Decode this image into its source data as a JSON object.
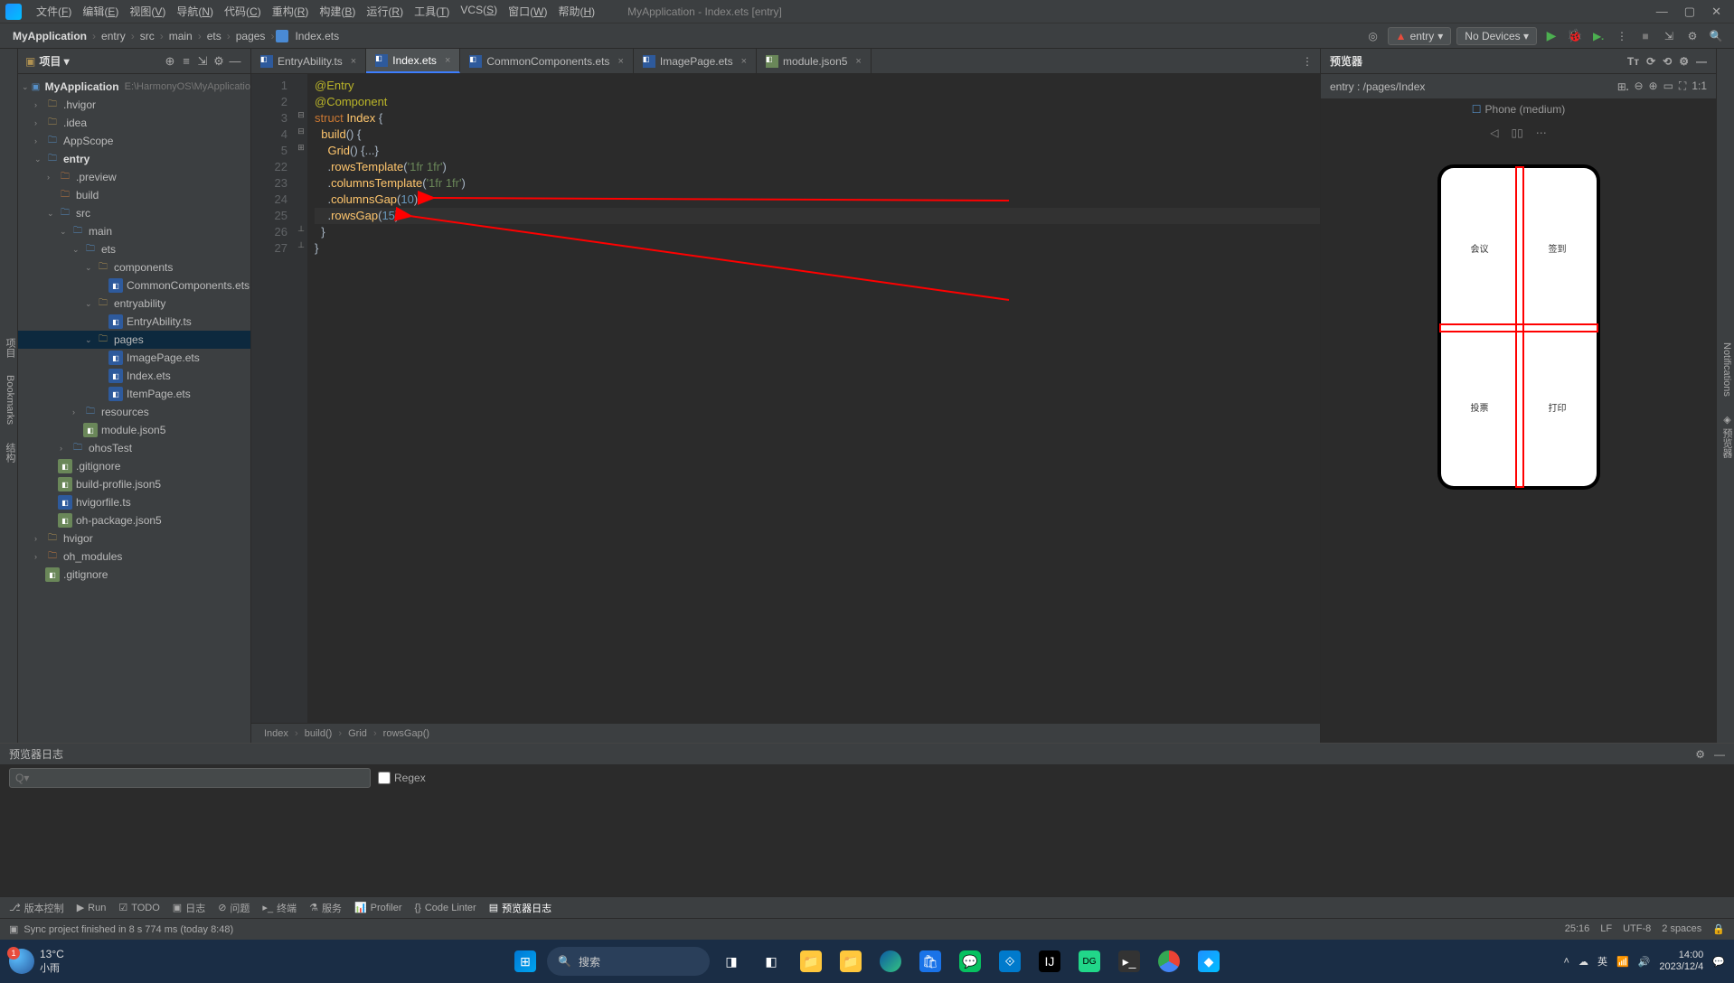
{
  "menubar": {
    "items": [
      "文件(F)",
      "编辑(E)",
      "视图(V)",
      "导航(N)",
      "代码(C)",
      "重构(R)",
      "构建(B)",
      "运行(R)",
      "工具(T)",
      "VCS(S)",
      "窗口(W)",
      "帮助(H)"
    ],
    "title": "MyApplication - Index.ets [entry]"
  },
  "breadcrumbs": [
    "MyApplication",
    "entry",
    "src",
    "main",
    "ets",
    "pages",
    "Index.ets"
  ],
  "navbar_right": {
    "entry_combo": "entry",
    "devices_combo": "No Devices ▾"
  },
  "project_panel": {
    "title": "项目 ▾",
    "root": {
      "name": "MyApplication",
      "path": "E:\\HarmonyOS\\MyApplicatio"
    },
    "tree": [
      {
        "d": 1,
        "a": "›",
        "i": "folder",
        "l": ".hvigor"
      },
      {
        "d": 1,
        "a": "›",
        "i": "folder",
        "l": ".idea"
      },
      {
        "d": 1,
        "a": "›",
        "i": "folder-blue",
        "l": "AppScope"
      },
      {
        "d": 1,
        "a": "⌄",
        "i": "folder-blue",
        "l": "entry",
        "bold": true
      },
      {
        "d": 2,
        "a": "›",
        "i": "folder-orange",
        "l": ".preview"
      },
      {
        "d": 2,
        "a": "",
        "i": "folder-orange",
        "l": "build"
      },
      {
        "d": 2,
        "a": "⌄",
        "i": "folder-blue",
        "l": "src"
      },
      {
        "d": 3,
        "a": "⌄",
        "i": "folder-blue",
        "l": "main"
      },
      {
        "d": 4,
        "a": "⌄",
        "i": "folder-blue",
        "l": "ets"
      },
      {
        "d": 5,
        "a": "⌄",
        "i": "folder",
        "l": "components"
      },
      {
        "d": 6,
        "a": "",
        "i": "file-ets",
        "l": "CommonComponents.ets"
      },
      {
        "d": 5,
        "a": "⌄",
        "i": "folder",
        "l": "entryability"
      },
      {
        "d": 6,
        "a": "",
        "i": "file-ts",
        "l": "EntryAbility.ts"
      },
      {
        "d": 5,
        "a": "⌄",
        "i": "folder",
        "l": "pages",
        "sel": true
      },
      {
        "d": 6,
        "a": "",
        "i": "file-ets",
        "l": "ImagePage.ets"
      },
      {
        "d": 6,
        "a": "",
        "i": "file-ets",
        "l": "Index.ets"
      },
      {
        "d": 6,
        "a": "",
        "i": "file-ets",
        "l": "ItemPage.ets"
      },
      {
        "d": 4,
        "a": "›",
        "i": "folder-blue",
        "l": "resources"
      },
      {
        "d": 4,
        "a": "",
        "i": "file-json",
        "l": "module.json5"
      },
      {
        "d": 3,
        "a": "›",
        "i": "folder-blue",
        "l": "ohosTest"
      },
      {
        "d": 2,
        "a": "",
        "i": "file-json",
        "l": ".gitignore"
      },
      {
        "d": 2,
        "a": "",
        "i": "file-json",
        "l": "build-profile.json5"
      },
      {
        "d": 2,
        "a": "",
        "i": "file-ts",
        "l": "hvigorfile.ts"
      },
      {
        "d": 2,
        "a": "",
        "i": "file-json",
        "l": "oh-package.json5"
      },
      {
        "d": 1,
        "a": "›",
        "i": "folder",
        "l": "hvigor"
      },
      {
        "d": 1,
        "a": "›",
        "i": "folder-orange",
        "l": "oh_modules"
      },
      {
        "d": 1,
        "a": "",
        "i": "file-json",
        "l": ".gitignore"
      }
    ]
  },
  "tabs": [
    {
      "label": "EntryAbility.ts",
      "icon": "file-ts"
    },
    {
      "label": "Index.ets",
      "icon": "file-ets",
      "active": true
    },
    {
      "label": "CommonComponents.ets",
      "icon": "file-ets"
    },
    {
      "label": "ImagePage.ets",
      "icon": "file-ets"
    },
    {
      "label": "module.json5",
      "icon": "file-json"
    }
  ],
  "code": {
    "line_numbers": [
      "1",
      "2",
      "3",
      "4",
      "5",
      "22",
      "23",
      "24",
      "25",
      "26",
      "27"
    ],
    "lines": [
      {
        "t": "@Entry",
        "cls": "ann"
      },
      {
        "t": "@Component",
        "cls": "ann"
      },
      {
        "raw": "<span class='kw'>struct</span> <span class='fn'>Index</span> {"
      },
      {
        "raw": "  <span class='fn'>build</span>() {"
      },
      {
        "raw": "    <span class='fn'>Grid</span>() {...}"
      },
      {
        "raw": "    .<span class='fn'>rowsTemplate</span>(<span class='str'>'1fr 1fr'</span>)"
      },
      {
        "raw": "    .<span class='fn'>columnsTemplate</span>(<span class='str'>'1fr 1fr'</span>)"
      },
      {
        "raw": "    .<span class='fn'>columnsGap</span>(<span class='num'>10</span>)"
      },
      {
        "raw": "    .<span class='fn'>rowsGap</span>(<span class='num'>15</span>)",
        "cur": true
      },
      {
        "t": "  }"
      },
      {
        "t": "}"
      }
    ]
  },
  "code_breadcrumb": [
    "Index",
    "build()",
    "Grid",
    "rowsGap()"
  ],
  "previewer": {
    "title": "预览器",
    "entry": "entry : /pages/Index",
    "device": "Phone (medium)",
    "cells": [
      "会议",
      "签到",
      "投票",
      "打印"
    ]
  },
  "bottom_panel": {
    "title": "预览器日志",
    "regex": "Regex",
    "search_placeholder": "Q▾"
  },
  "tool_windows": [
    "版本控制",
    "Run",
    "TODO",
    "日志",
    "问题",
    "终端",
    "服务",
    "Profiler",
    "Code Linter",
    "预览器日志"
  ],
  "statusbar": {
    "msg": "Sync project finished in 8 s 774 ms (today 8:48)",
    "pos": "25:16",
    "le": "LF",
    "enc": "UTF-8",
    "ind": "2 spaces"
  },
  "taskbar": {
    "temp": "13°C",
    "weather": "小雨",
    "badge": "1",
    "search": "搜索",
    "ime": "英",
    "time": "14:00",
    "date": "2023/12/4"
  }
}
